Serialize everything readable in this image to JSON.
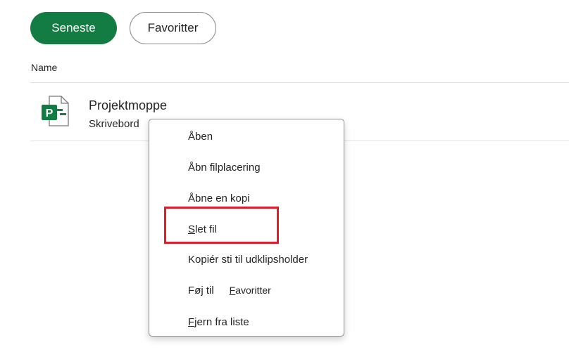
{
  "tabs": {
    "recent_label": "Seneste",
    "favorites_label": "Favoritter"
  },
  "list": {
    "column_name": "Name",
    "files": [
      {
        "name": "Projektmoppe",
        "location": "Skrivebord",
        "icon": "project-file-icon"
      }
    ]
  },
  "context_menu": {
    "items": [
      {
        "label": "Åben"
      },
      {
        "label": "Åbn filplacering"
      },
      {
        "label": "Åbne en kopi"
      },
      {
        "label": "Slet fil",
        "highlighted": true
      },
      {
        "label": "Kopiér sti til udklipsholder"
      },
      {
        "label": "Føj til",
        "sub": "Favoritter"
      },
      {
        "label": "Fjern fra liste"
      }
    ]
  },
  "colors": {
    "accent": "#137c43",
    "highlight": "#e01e2b"
  }
}
